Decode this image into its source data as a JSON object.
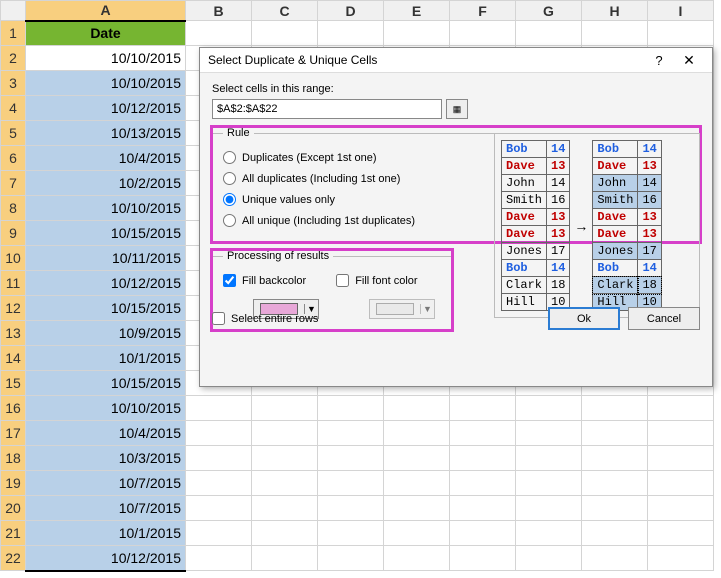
{
  "columns": [
    "A",
    "B",
    "C",
    "D",
    "E",
    "F",
    "G",
    "H",
    "I"
  ],
  "rows_count": 22,
  "header_cell": "Date",
  "col_widths": {
    "A": 160,
    "other": 66
  },
  "data": [
    "10/10/2015",
    "10/10/2015",
    "10/12/2015",
    "10/13/2015",
    "10/4/2015",
    "10/2/2015",
    "10/10/2015",
    "10/15/2015",
    "10/11/2015",
    "10/12/2015",
    "10/15/2015",
    "10/9/2015",
    "10/1/2015",
    "10/15/2015",
    "10/10/2015",
    "10/4/2015",
    "10/3/2015",
    "10/7/2015",
    "10/7/2015",
    "10/1/2015",
    "10/12/2015"
  ],
  "active_row": 2,
  "selected_col": "A",
  "dialog": {
    "title": "Select Duplicate & Unique Cells",
    "help": "?",
    "close": "✕",
    "range_label": "Select cells in this range:",
    "range_value": "$A$2:$A$22",
    "rule_legend": "Rule",
    "rules": {
      "duplicates_except": "Duplicates (Except 1st one)",
      "all_duplicates": "All duplicates (Including 1st one)",
      "unique_only": "Unique values only",
      "all_unique": "All unique (Including 1st duplicates)"
    },
    "selected_rule": "unique_only",
    "proc_legend": "Processing of results",
    "fill_back": "Fill backcolor",
    "fill_font": "Fill font color",
    "fill_back_checked": true,
    "fill_font_checked": false,
    "back_color": "#e8a8d8",
    "font_color": "#e0e0e0",
    "select_entire": "Select entire rows",
    "ok": "Ok",
    "cancel": "Cancel"
  },
  "preview": {
    "arrow": "→",
    "left": [
      {
        "name": "Bob",
        "n": "14",
        "cls": "pv-blue"
      },
      {
        "name": "Dave",
        "n": "13",
        "cls": "pv-red"
      },
      {
        "name": "John",
        "n": "14",
        "cls": ""
      },
      {
        "name": "Smith",
        "n": "16",
        "cls": ""
      },
      {
        "name": "Dave",
        "n": "13",
        "cls": "pv-red"
      },
      {
        "name": "Dave",
        "n": "13",
        "cls": "pv-red"
      },
      {
        "name": "Jones",
        "n": "17",
        "cls": ""
      },
      {
        "name": "Bob",
        "n": "14",
        "cls": "pv-blue"
      },
      {
        "name": "Clark",
        "n": "18",
        "cls": ""
      },
      {
        "name": "Hill",
        "n": "10",
        "cls": ""
      }
    ],
    "right": [
      {
        "name": "Bob",
        "n": "14",
        "cls": "pv-blue",
        "hl": ""
      },
      {
        "name": "Dave",
        "n": "13",
        "cls": "pv-red",
        "hl": ""
      },
      {
        "name": "John",
        "n": "14",
        "cls": "",
        "hl": "hl-blue"
      },
      {
        "name": "Smith",
        "n": "16",
        "cls": "",
        "hl": "hl-blue"
      },
      {
        "name": "Dave",
        "n": "13",
        "cls": "pv-red",
        "hl": ""
      },
      {
        "name": "Dave",
        "n": "13",
        "cls": "pv-red",
        "hl": ""
      },
      {
        "name": "Jones",
        "n": "17",
        "cls": "",
        "hl": "hl-blue"
      },
      {
        "name": "Bob",
        "n": "14",
        "cls": "pv-blue",
        "hl": ""
      },
      {
        "name": "Clark",
        "n": "18",
        "cls": "",
        "hl": "hl-sel"
      },
      {
        "name": "Hill",
        "n": "10",
        "cls": "",
        "hl": "hl-blue"
      }
    ]
  }
}
